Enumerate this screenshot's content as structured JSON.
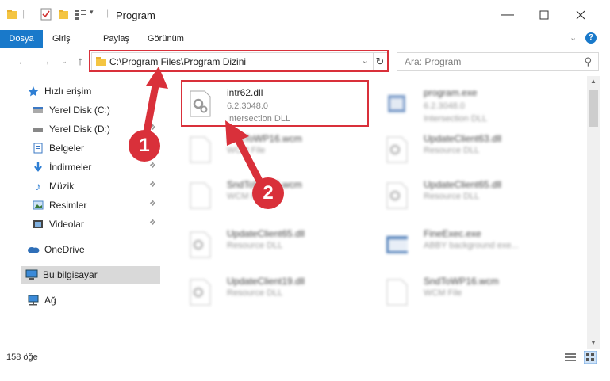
{
  "window": {
    "title": "Program"
  },
  "ribbon": {
    "tabs": [
      "Dosya",
      "Giriş",
      "Paylaş",
      "Görünüm"
    ]
  },
  "address": {
    "path": "C:\\Program Files\\Program Dizini"
  },
  "search": {
    "placeholder": "Ara: Program"
  },
  "sidebar": {
    "items": [
      {
        "label": "Hızlı erişim",
        "icon": "star-icon",
        "pinned": false
      },
      {
        "label": "Yerel Disk (C:)",
        "icon": "drive-icon",
        "pinned": true
      },
      {
        "label": "Yerel Disk (D:)",
        "icon": "drive-icon",
        "pinned": true
      },
      {
        "label": "Belgeler",
        "icon": "documents-icon",
        "pinned": true
      },
      {
        "label": "İndirmeler",
        "icon": "download-icon",
        "pinned": true
      },
      {
        "label": "Müzik",
        "icon": "music-icon",
        "pinned": true
      },
      {
        "label": "Resimler",
        "icon": "pictures-icon",
        "pinned": true
      },
      {
        "label": "Videolar",
        "icon": "videos-icon",
        "pinned": true
      },
      {
        "label": "OneDrive",
        "icon": "cloud-icon",
        "pinned": false
      },
      {
        "label": "Bu bilgisayar",
        "icon": "computer-icon",
        "pinned": false,
        "selected": true
      },
      {
        "label": "Ağ",
        "icon": "network-icon",
        "pinned": false
      }
    ]
  },
  "files": [
    {
      "name": "intr62.dll",
      "version": "6.2.3048.0",
      "type": "Intersection DLL",
      "highlighted": true
    },
    {
      "name": "program.exe",
      "version": "6.2.3048.0",
      "type": "Intersection DLL"
    },
    {
      "name": "SndToWP16.wcm",
      "version": "",
      "type": "WCM File"
    },
    {
      "name": "UpdateClient63.dll",
      "version": "",
      "type": "Resource DLL"
    },
    {
      "name": "SndToWP16.wcm",
      "version": "",
      "type": "WCM File"
    },
    {
      "name": "UpdateClient65.dll",
      "version": "",
      "type": "Resource DLL"
    },
    {
      "name": "UpdateClient65.dll",
      "version": "",
      "type": "Resource DLL"
    },
    {
      "name": "FineExec.exe",
      "version": "",
      "type": "ABBY background exe..."
    },
    {
      "name": "UpdateClient19.dll",
      "version": "",
      "type": "Resource DLL"
    },
    {
      "name": "SndToWP16.wcm",
      "version": "",
      "type": "WCM File"
    }
  ],
  "status": {
    "count": "158 öğe"
  },
  "callouts": [
    "1",
    "2"
  ],
  "colors": {
    "accent": "#1979ca",
    "highlight": "#d9303a"
  }
}
